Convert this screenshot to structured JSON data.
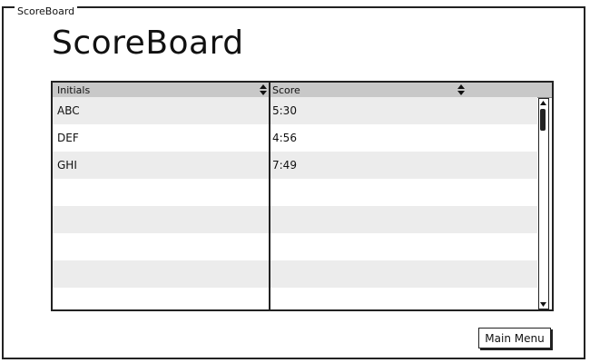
{
  "window": {
    "title": "ScoreBoard"
  },
  "header": {
    "title": "ScoreBoard"
  },
  "table": {
    "columns": [
      "Initials",
      "Score"
    ],
    "rows": [
      {
        "initials": "ABC",
        "score": "5:30"
      },
      {
        "initials": "DEF",
        "score": "4:56"
      },
      {
        "initials": "GHI",
        "score": "7:49"
      },
      {
        "initials": "",
        "score": ""
      },
      {
        "initials": "",
        "score": ""
      },
      {
        "initials": "",
        "score": ""
      },
      {
        "initials": "",
        "score": ""
      },
      {
        "initials": "",
        "score": ""
      }
    ]
  },
  "footer": {
    "main_menu_label": "Main Menu"
  },
  "icons": {
    "sort": "sort-icon",
    "scroll_up": "arrow-up-icon",
    "scroll_down": "arrow-down-icon"
  }
}
